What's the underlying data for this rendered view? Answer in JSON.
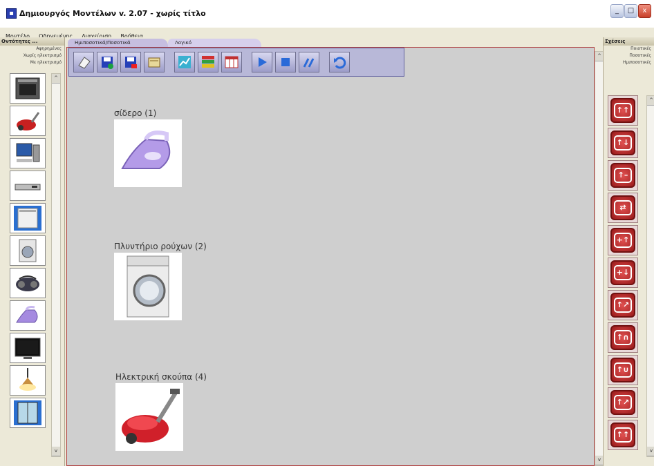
{
  "window": {
    "title": "Δημιουργός Μοντέλων v. 2.07 - χωρίς τίτλο",
    "minimize_label": "_",
    "maximize_label": "□",
    "close_label": "x"
  },
  "menu": [
    "Μοντέλο",
    "Οδηγεμένης",
    "Διαχείριση",
    "Βοήθεια"
  ],
  "left_panel": {
    "header": "Οντότητες ...",
    "rows": [
      "Αφηρημένες",
      "Χωρίς ηλεκτρισμό",
      "Με ηλεκτρισμό"
    ],
    "icons": [
      "oven-icon",
      "vacuum-icon",
      "computer-icon",
      "dvd-player-icon",
      "dishwasher-icon",
      "washing-machine-icon",
      "radio-icon",
      "iron-icon",
      "tv-icon",
      "lamp-icon",
      "fridge-icon"
    ],
    "scroll_up": "^",
    "scroll_down": "v"
  },
  "tabs": [
    "Ημιποσοτικά/Ποσοτικά",
    "Λογικό"
  ],
  "toolbar": [
    "new-icon",
    "save-icon",
    "save-as-icon",
    "open-icon",
    "graph-icon",
    "chart-icon",
    "table-icon",
    "play-icon",
    "stop-icon",
    "step-icon",
    "undo-icon"
  ],
  "canvas": {
    "devices": [
      {
        "label": "σίδερο (1)",
        "icon": "iron-icon"
      },
      {
        "label": "Πλυντήριο ρούχων (2)",
        "icon": "washing-machine-icon"
      },
      {
        "label": "Ηλεκτρική σκούπα (4)",
        "icon": "vacuum-icon"
      }
    ],
    "scroll_up": "^",
    "scroll_down": "v"
  },
  "right_panel": {
    "header": "Σχέσεις",
    "rows": [
      "Ποιοτικές",
      "Ποσοτικές",
      "Ημιποσοτικές"
    ],
    "relations": [
      "↑↑",
      "↑↓",
      "↑–",
      "⇄",
      "+↑",
      "+↓",
      "↑↗",
      "↑∩",
      "↑∪",
      "↑↗",
      "↑↑"
    ],
    "scroll_up": "^",
    "scroll_down": "v"
  }
}
